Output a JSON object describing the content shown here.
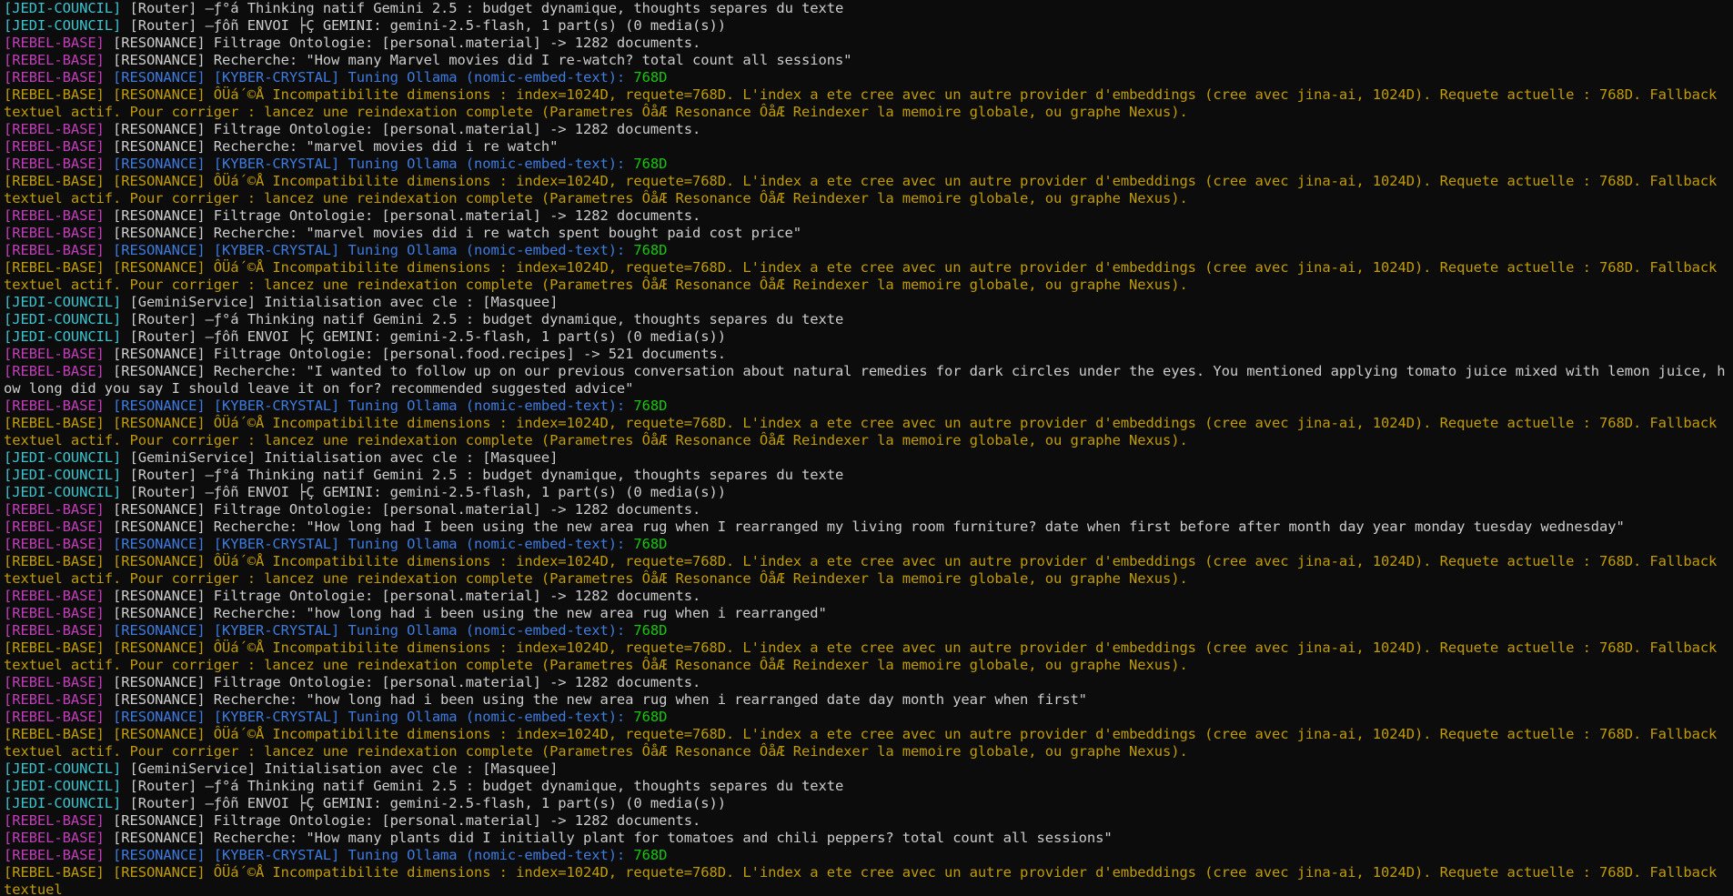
{
  "colors": {
    "jedi": "#3ac4cf",
    "rebel": "#c33cb9",
    "plain": "#cccccc",
    "blue": "#3c7bdf",
    "green": "#16c60c",
    "warn": "#c19c00"
  },
  "lines": [
    [
      {
        "t": "[JEDI-COUNCIL] ",
        "c": "jedi"
      },
      {
        "t": "[Router] –ƒ°á Thinking natif Gemini 2.5 : budget dynamique, thoughts separes du texte",
        "c": "plain"
      }
    ],
    [
      {
        "t": "[JEDI-COUNCIL] ",
        "c": "jedi"
      },
      {
        "t": "[Router] –ƒôñ ENVOI ├Ç GEMINI: gemini-2.5-flash, 1 part(s) (0 media(s))",
        "c": "plain"
      }
    ],
    [
      {
        "t": "[REBEL-BASE] ",
        "c": "rebel"
      },
      {
        "t": "[RESONANCE] Filtrage Ontologie: [personal.material] -> 1282 documents.",
        "c": "plain"
      }
    ],
    [
      {
        "t": "[REBEL-BASE] ",
        "c": "rebel"
      },
      {
        "t": "[RESONANCE] Recherche: \"How many Marvel movies did I re-watch? total count all sessions\"",
        "c": "plain"
      }
    ],
    [
      {
        "t": "[REBEL-BASE] ",
        "c": "rebel"
      },
      {
        "t": "[RESONANCE] [KYBER-CRYSTAL] Tuning Ollama (nomic-embed-text): ",
        "c": "blue"
      },
      {
        "t": "768D",
        "c": "green"
      }
    ],
    [
      {
        "t": "[REBEL-BASE] ",
        "c": "warn"
      },
      {
        "t": "[RESONANCE] ÔÜá´©Å Incompatibilite dimensions : index=1024D, requete=768D. L'index a ete cree avec un autre provider d'embeddings (cree avec jina-ai, 1024D). Requete actuelle : 768D. Fallback textuel actif. Pour corriger : lancez une reindexation complete (Parametres ÔåÆ Resonance ÔåÆ Reindexer la memoire globale, ou graphe Nexus).",
        "c": "warn"
      }
    ],
    [
      {
        "t": "[REBEL-BASE] ",
        "c": "rebel"
      },
      {
        "t": "[RESONANCE] Filtrage Ontologie: [personal.material] -> 1282 documents.",
        "c": "plain"
      }
    ],
    [
      {
        "t": "[REBEL-BASE] ",
        "c": "rebel"
      },
      {
        "t": "[RESONANCE] Recherche: \"marvel movies did i re watch\"",
        "c": "plain"
      }
    ],
    [
      {
        "t": "[REBEL-BASE] ",
        "c": "rebel"
      },
      {
        "t": "[RESONANCE] [KYBER-CRYSTAL] Tuning Ollama (nomic-embed-text): ",
        "c": "blue"
      },
      {
        "t": "768D",
        "c": "green"
      }
    ],
    [
      {
        "t": "[REBEL-BASE] ",
        "c": "warn"
      },
      {
        "t": "[RESONANCE] ÔÜá´©Å Incompatibilite dimensions : index=1024D, requete=768D. L'index a ete cree avec un autre provider d'embeddings (cree avec jina-ai, 1024D). Requete actuelle : 768D. Fallback textuel actif. Pour corriger : lancez une reindexation complete (Parametres ÔåÆ Resonance ÔåÆ Reindexer la memoire globale, ou graphe Nexus).",
        "c": "warn"
      }
    ],
    [
      {
        "t": "[REBEL-BASE] ",
        "c": "rebel"
      },
      {
        "t": "[RESONANCE] Filtrage Ontologie: [personal.material] -> 1282 documents.",
        "c": "plain"
      }
    ],
    [
      {
        "t": "[REBEL-BASE] ",
        "c": "rebel"
      },
      {
        "t": "[RESONANCE] Recherche: \"marvel movies did i re watch spent bought paid cost price\"",
        "c": "plain"
      }
    ],
    [
      {
        "t": "[REBEL-BASE] ",
        "c": "rebel"
      },
      {
        "t": "[RESONANCE] [KYBER-CRYSTAL] Tuning Ollama (nomic-embed-text): ",
        "c": "blue"
      },
      {
        "t": "768D",
        "c": "green"
      }
    ],
    [
      {
        "t": "[REBEL-BASE] ",
        "c": "warn"
      },
      {
        "t": "[RESONANCE] ÔÜá´©Å Incompatibilite dimensions : index=1024D, requete=768D. L'index a ete cree avec un autre provider d'embeddings (cree avec jina-ai, 1024D). Requete actuelle : 768D. Fallback textuel actif. Pour corriger : lancez une reindexation complete (Parametres ÔåÆ Resonance ÔåÆ Reindexer la memoire globale, ou graphe Nexus).",
        "c": "warn"
      }
    ],
    [
      {
        "t": "[JEDI-COUNCIL] ",
        "c": "jedi"
      },
      {
        "t": "[GeminiService] Initialisation avec cle : [Masquee]",
        "c": "plain"
      }
    ],
    [
      {
        "t": "[JEDI-COUNCIL] ",
        "c": "jedi"
      },
      {
        "t": "[Router] –ƒ°á Thinking natif Gemini 2.5 : budget dynamique, thoughts separes du texte",
        "c": "plain"
      }
    ],
    [
      {
        "t": "[JEDI-COUNCIL] ",
        "c": "jedi"
      },
      {
        "t": "[Router] –ƒôñ ENVOI ├Ç GEMINI: gemini-2.5-flash, 1 part(s) (0 media(s))",
        "c": "plain"
      }
    ],
    [
      {
        "t": "[REBEL-BASE] ",
        "c": "rebel"
      },
      {
        "t": "[RESONANCE] Filtrage Ontologie: [personal.food.recipes] -> 521 documents.",
        "c": "plain"
      }
    ],
    [
      {
        "t": "[REBEL-BASE] ",
        "c": "rebel"
      },
      {
        "t": "[RESONANCE] Recherche: \"I wanted to follow up on our previous conversation about natural remedies for dark circles under the eyes. You mentioned applying tomato juice mixed with lemon juice, how long did you say I should leave it on for? recommended suggested advice\"",
        "c": "plain"
      }
    ],
    [
      {
        "t": "[REBEL-BASE] ",
        "c": "rebel"
      },
      {
        "t": "[RESONANCE] [KYBER-CRYSTAL] Tuning Ollama (nomic-embed-text): ",
        "c": "blue"
      },
      {
        "t": "768D",
        "c": "green"
      }
    ],
    [
      {
        "t": "[REBEL-BASE] ",
        "c": "warn"
      },
      {
        "t": "[RESONANCE] ÔÜá´©Å Incompatibilite dimensions : index=1024D, requete=768D. L'index a ete cree avec un autre provider d'embeddings (cree avec jina-ai, 1024D). Requete actuelle : 768D. Fallback textuel actif. Pour corriger : lancez une reindexation complete (Parametres ÔåÆ Resonance ÔåÆ Reindexer la memoire globale, ou graphe Nexus).",
        "c": "warn"
      }
    ],
    [
      {
        "t": "[JEDI-COUNCIL] ",
        "c": "jedi"
      },
      {
        "t": "[GeminiService] Initialisation avec cle : [Masquee]",
        "c": "plain"
      }
    ],
    [
      {
        "t": "[JEDI-COUNCIL] ",
        "c": "jedi"
      },
      {
        "t": "[Router] –ƒ°á Thinking natif Gemini 2.5 : budget dynamique, thoughts separes du texte",
        "c": "plain"
      }
    ],
    [
      {
        "t": "[JEDI-COUNCIL] ",
        "c": "jedi"
      },
      {
        "t": "[Router] –ƒôñ ENVOI ├Ç GEMINI: gemini-2.5-flash, 1 part(s) (0 media(s))",
        "c": "plain"
      }
    ],
    [
      {
        "t": "[REBEL-BASE] ",
        "c": "rebel"
      },
      {
        "t": "[RESONANCE] Filtrage Ontologie: [personal.material] -> 1282 documents.",
        "c": "plain"
      }
    ],
    [
      {
        "t": "[REBEL-BASE] ",
        "c": "rebel"
      },
      {
        "t": "[RESONANCE] Recherche: \"How long had I been using the new area rug when I rearranged my living room furniture? date when first before after month day year monday tuesday wednesday\"",
        "c": "plain"
      }
    ],
    [
      {
        "t": "[REBEL-BASE] ",
        "c": "rebel"
      },
      {
        "t": "[RESONANCE] [KYBER-CRYSTAL] Tuning Ollama (nomic-embed-text): ",
        "c": "blue"
      },
      {
        "t": "768D",
        "c": "green"
      }
    ],
    [
      {
        "t": "[REBEL-BASE] ",
        "c": "warn"
      },
      {
        "t": "[RESONANCE] ÔÜá´©Å Incompatibilite dimensions : index=1024D, requete=768D. L'index a ete cree avec un autre provider d'embeddings (cree avec jina-ai, 1024D). Requete actuelle : 768D. Fallback textuel actif. Pour corriger : lancez une reindexation complete (Parametres ÔåÆ Resonance ÔåÆ Reindexer la memoire globale, ou graphe Nexus).",
        "c": "warn"
      }
    ],
    [
      {
        "t": "[REBEL-BASE] ",
        "c": "rebel"
      },
      {
        "t": "[RESONANCE] Filtrage Ontologie: [personal.material] -> 1282 documents.",
        "c": "plain"
      }
    ],
    [
      {
        "t": "[REBEL-BASE] ",
        "c": "rebel"
      },
      {
        "t": "[RESONANCE] Recherche: \"how long had i been using the new area rug when i rearranged\"",
        "c": "plain"
      }
    ],
    [
      {
        "t": "[REBEL-BASE] ",
        "c": "rebel"
      },
      {
        "t": "[RESONANCE] [KYBER-CRYSTAL] Tuning Ollama (nomic-embed-text): ",
        "c": "blue"
      },
      {
        "t": "768D",
        "c": "green"
      }
    ],
    [
      {
        "t": "[REBEL-BASE] ",
        "c": "warn"
      },
      {
        "t": "[RESONANCE] ÔÜá´©Å Incompatibilite dimensions : index=1024D, requete=768D. L'index a ete cree avec un autre provider d'embeddings (cree avec jina-ai, 1024D). Requete actuelle : 768D. Fallback textuel actif. Pour corriger : lancez une reindexation complete (Parametres ÔåÆ Resonance ÔåÆ Reindexer la memoire globale, ou graphe Nexus).",
        "c": "warn"
      }
    ],
    [
      {
        "t": "[REBEL-BASE] ",
        "c": "rebel"
      },
      {
        "t": "[RESONANCE] Filtrage Ontologie: [personal.material] -> 1282 documents.",
        "c": "plain"
      }
    ],
    [
      {
        "t": "[REBEL-BASE] ",
        "c": "rebel"
      },
      {
        "t": "[RESONANCE] Recherche: \"how long had i been using the new area rug when i rearranged date day month year when first\"",
        "c": "plain"
      }
    ],
    [
      {
        "t": "[REBEL-BASE] ",
        "c": "rebel"
      },
      {
        "t": "[RESONANCE] [KYBER-CRYSTAL] Tuning Ollama (nomic-embed-text): ",
        "c": "blue"
      },
      {
        "t": "768D",
        "c": "green"
      }
    ],
    [
      {
        "t": "[REBEL-BASE] ",
        "c": "warn"
      },
      {
        "t": "[RESONANCE] ÔÜá´©Å Incompatibilite dimensions : index=1024D, requete=768D. L'index a ete cree avec un autre provider d'embeddings (cree avec jina-ai, 1024D). Requete actuelle : 768D. Fallback textuel actif. Pour corriger : lancez une reindexation complete (Parametres ÔåÆ Resonance ÔåÆ Reindexer la memoire globale, ou graphe Nexus).",
        "c": "warn"
      }
    ],
    [
      {
        "t": "[JEDI-COUNCIL] ",
        "c": "jedi"
      },
      {
        "t": "[GeminiService] Initialisation avec cle : [Masquee]",
        "c": "plain"
      }
    ],
    [
      {
        "t": "[JEDI-COUNCIL] ",
        "c": "jedi"
      },
      {
        "t": "[Router] –ƒ°á Thinking natif Gemini 2.5 : budget dynamique, thoughts separes du texte",
        "c": "plain"
      }
    ],
    [
      {
        "t": "[JEDI-COUNCIL] ",
        "c": "jedi"
      },
      {
        "t": "[Router] –ƒôñ ENVOI ├Ç GEMINI: gemini-2.5-flash, 1 part(s) (0 media(s))",
        "c": "plain"
      }
    ],
    [
      {
        "t": "[REBEL-BASE] ",
        "c": "rebel"
      },
      {
        "t": "[RESONANCE] Filtrage Ontologie: [personal.material] -> 1282 documents.",
        "c": "plain"
      }
    ],
    [
      {
        "t": "[REBEL-BASE] ",
        "c": "rebel"
      },
      {
        "t": "[RESONANCE] Recherche: \"How many plants did I initially plant for tomatoes and chili peppers? total count all sessions\"",
        "c": "plain"
      }
    ],
    [
      {
        "t": "[REBEL-BASE] ",
        "c": "rebel"
      },
      {
        "t": "[RESONANCE] [KYBER-CRYSTAL] Tuning Ollama (nomic-embed-text): ",
        "c": "blue"
      },
      {
        "t": "768D",
        "c": "green"
      }
    ],
    [
      {
        "t": "[REBEL-BASE] ",
        "c": "warn"
      },
      {
        "t": "[RESONANCE] ÔÜá´©Å Incompatibilite dimensions : index=1024D, requete=768D. L'index a ete cree avec un autre provider d'embeddings (cree avec jina-ai, 1024D). Requete actuelle : 768D. Fallback textuel",
        "c": "warn"
      }
    ]
  ]
}
